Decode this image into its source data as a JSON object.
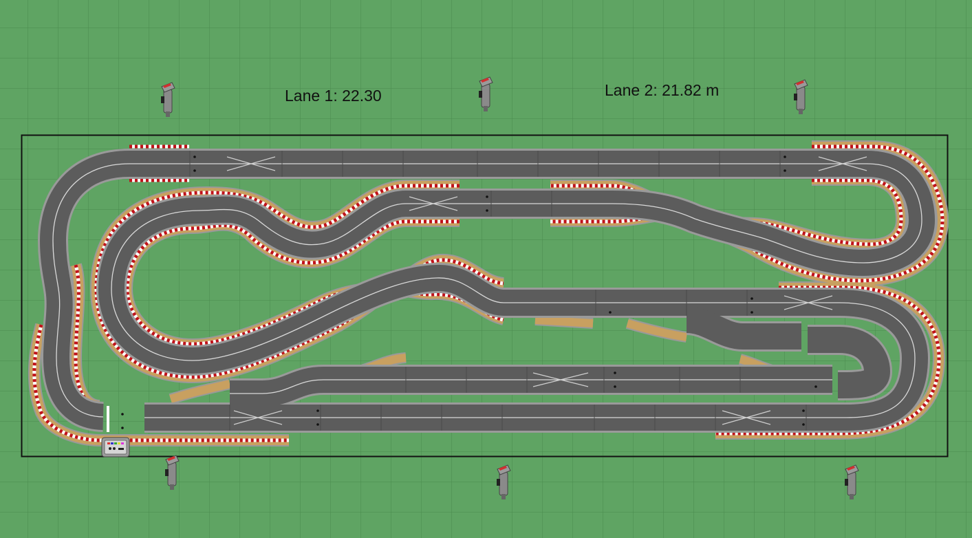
{
  "lane_labels": {
    "lane1": "Lane 1: 22.30",
    "lane2": "Lane 2: 21.82 m"
  },
  "colors": {
    "grass": "#5fa463",
    "grid_line": "#4a8a4e",
    "track_asphalt": "#5c5c5c",
    "track_edge": "#9a9a9a",
    "lane_line": "#d9d9d9",
    "border_strip": "#c8a060",
    "curb_red": "#c0121a",
    "curb_white": "#ffffff",
    "table_border": "#111111"
  },
  "icons": {
    "controller": "hand-controller-icon",
    "power_base": "lap-counter-power-base-icon"
  }
}
